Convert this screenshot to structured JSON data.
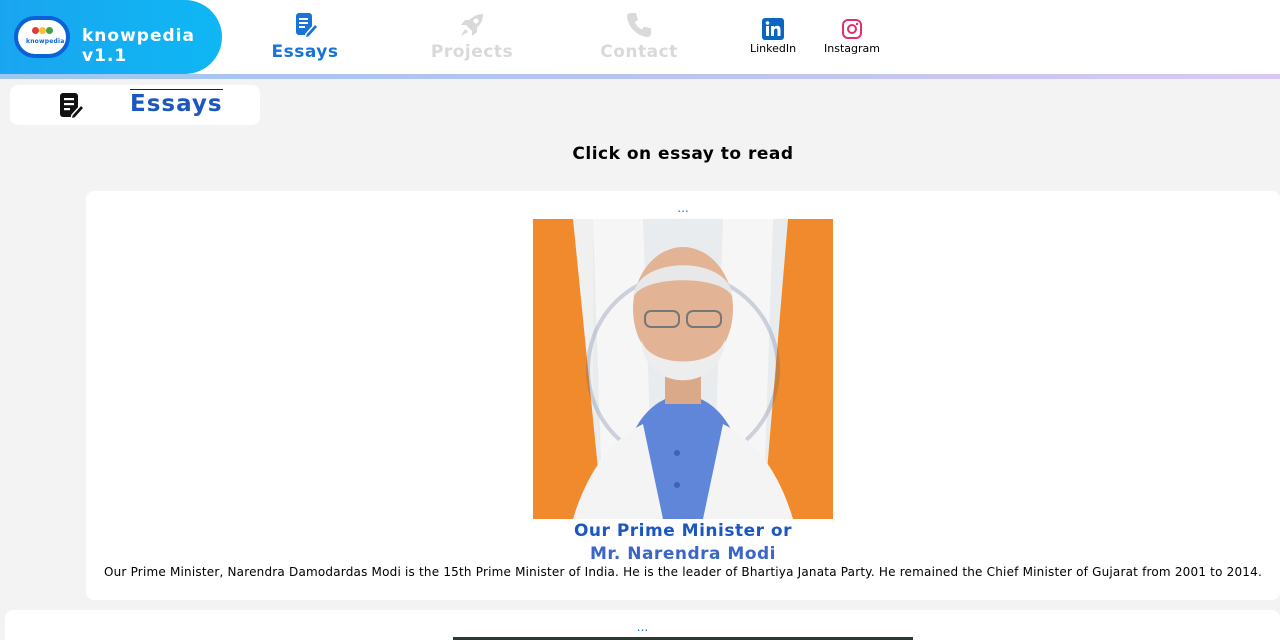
{
  "header": {
    "brand_mini": "knowpedia",
    "brand": "knowpedia v1.1",
    "nav": [
      {
        "label": "Essays",
        "icon": "essay-icon",
        "active": true
      },
      {
        "label": "Projects",
        "icon": "rocket-icon",
        "active": false
      },
      {
        "label": "Contact",
        "icon": "phone-icon",
        "active": false
      }
    ],
    "social": [
      {
        "label": "LinkedIn",
        "icon": "linkedin-icon"
      },
      {
        "label": "Instagram",
        "icon": "instagram-icon"
      }
    ]
  },
  "section": {
    "title": "Essays",
    "icon": "essay-icon"
  },
  "instruction": "Click on essay to read",
  "essays": [
    {
      "dots": "...",
      "title_line1": "Our Prime Minister or",
      "title_line2": "Mr. Narendra Modi",
      "description": "Our Prime Minister, Narendra Damodardas Modi is the 15th Prime Minister of India. He is the leader of Bhartiya Janata Party. He remained the Chief Minister of Gujarat from 2001 to 2014."
    },
    {
      "dots": "..."
    }
  ],
  "colors": {
    "accent": "#1a73d9",
    "logo_bg": "#12aef2",
    "title_blue": "#1c57c0",
    "title_purple": "#8a3fc0"
  }
}
